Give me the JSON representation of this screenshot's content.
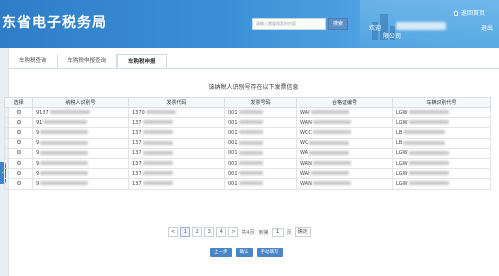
{
  "header": {
    "title": "东省电子税务局",
    "search_placeholder": "请输入需要搜索的内容",
    "search_button": "搜索",
    "home_link": "返回首页",
    "welcome": "欢迎",
    "company_suffix": "限公司",
    "logout": "退出"
  },
  "tabs": [
    {
      "label": "车购税查询",
      "active": false
    },
    {
      "label": "车购税申报查询",
      "active": false
    },
    {
      "label": "车购税申报",
      "active": true
    }
  ],
  "caption": "该纳税人识别号存在以下发票信息",
  "table": {
    "columns": [
      "选择",
      "纳税人识别号",
      "发票代码",
      "发票号码",
      "合格证编号",
      "车辆识别代号"
    ],
    "rows": [
      [
        "",
        "9137",
        "1370",
        "001",
        "WAI",
        "LGW"
      ],
      [
        "",
        "91",
        "137",
        "001",
        "WAN",
        "LGW"
      ],
      [
        "",
        "9",
        "137",
        "001",
        "WCC",
        "LB"
      ],
      [
        "",
        "9",
        "137",
        "001",
        "WC",
        "LB"
      ],
      [
        "",
        "9",
        "137",
        "001",
        "WA",
        "LGW"
      ],
      [
        "",
        "9",
        "137",
        "001",
        "WAN",
        "LGW"
      ],
      [
        "",
        "9",
        "137",
        "001",
        "WAI",
        "LGW"
      ],
      [
        "",
        "9",
        "137",
        "001",
        "WAN",
        "LGW"
      ]
    ]
  },
  "pager": {
    "prev": "<",
    "pages": [
      "1",
      "2",
      "3",
      "4"
    ],
    "current": "1",
    "next": ">",
    "total_text": "共4页",
    "goto_label": "到第",
    "goto_value": "1",
    "page_unit": "页",
    "confirm": "确定"
  },
  "actions": {
    "prev_step": "上一步",
    "confirm": "确认",
    "manual_fill": "手动填写"
  }
}
